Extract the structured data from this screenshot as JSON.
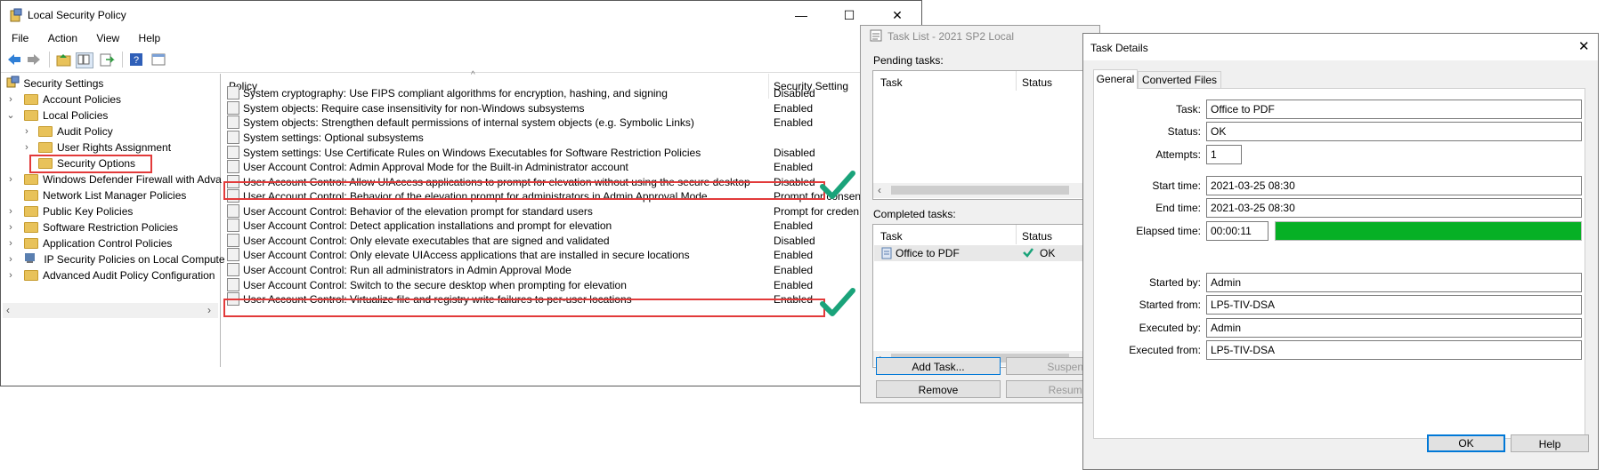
{
  "lsp": {
    "title": "Local Security Policy",
    "controls": {
      "minimize": "—",
      "maximize": "☐",
      "close": "✕"
    },
    "menu": [
      "File",
      "Action",
      "View",
      "Help"
    ],
    "tree": [
      {
        "label": "Security Settings",
        "level": 0
      },
      {
        "label": "Account Policies",
        "level": 1
      },
      {
        "label": "Local Policies",
        "level": 1
      },
      {
        "label": "Audit Policy",
        "level": 2
      },
      {
        "label": "User Rights Assignment",
        "level": 2
      },
      {
        "label": "Security Options",
        "level": 2
      },
      {
        "label": "Windows Defender Firewall with Adva",
        "level": 1
      },
      {
        "label": "Network List Manager Policies",
        "level": 1
      },
      {
        "label": "Public Key Policies",
        "level": 1
      },
      {
        "label": "Software Restriction Policies",
        "level": 1
      },
      {
        "label": "Application Control Policies",
        "level": 1
      },
      {
        "label": "IP Security Policies on Local Compute",
        "level": 1
      },
      {
        "label": "Advanced Audit Policy Configuration",
        "level": 1
      }
    ],
    "columns": {
      "policy": "Policy",
      "setting": "Security Setting"
    },
    "rows": [
      {
        "policy": "System cryptography: Use FIPS compliant algorithms for encryption, hashing, and signing",
        "setting": "Disabled"
      },
      {
        "policy": "System objects: Require case insensitivity for non-Windows subsystems",
        "setting": "Enabled"
      },
      {
        "policy": "System objects: Strengthen default permissions of internal system objects (e.g. Symbolic Links)",
        "setting": "Enabled"
      },
      {
        "policy": "System settings: Optional subsystems",
        "setting": ""
      },
      {
        "policy": "System settings: Use Certificate Rules on Windows Executables for Software Restriction Policies",
        "setting": "Disabled"
      },
      {
        "policy": "User Account Control: Admin Approval Mode for the Built-in Administrator account",
        "setting": "Enabled"
      },
      {
        "policy": "User Account Control: Allow UIAccess applications to prompt for elevation without using the secure desktop",
        "setting": "Disabled"
      },
      {
        "policy": "User Account Control: Behavior of the elevation prompt for administrators in Admin Approval Mode",
        "setting": "Prompt for consen"
      },
      {
        "policy": "User Account Control: Behavior of the elevation prompt for standard users",
        "setting": "Prompt for creden"
      },
      {
        "policy": "User Account Control: Detect application installations and prompt for elevation",
        "setting": "Enabled"
      },
      {
        "policy": "User Account Control: Only elevate executables that are signed and validated",
        "setting": "Disabled"
      },
      {
        "policy": "User Account Control: Only elevate UIAccess applications that are installed in secure locations",
        "setting": "Enabled"
      },
      {
        "policy": "User Account Control: Run all administrators in Admin Approval Mode",
        "setting": "Enabled"
      },
      {
        "policy": "User Account Control: Switch to the secure desktop when prompting for elevation",
        "setting": "Enabled"
      },
      {
        "policy": "User Account Control: Virtualize file and registry write failures to per-user locations",
        "setting": "Enabled"
      }
    ]
  },
  "tasklist": {
    "title": "Task List - 2021 SP2 Local",
    "pending_label": "Pending tasks:",
    "completed_label": "Completed tasks:",
    "col_task": "Task",
    "col_status": "Status",
    "completed_rows": [
      {
        "task": "Office to PDF",
        "status": "OK"
      }
    ],
    "buttons": {
      "add": "Add Task...",
      "suspend": "Suspend",
      "remove": "Remove",
      "resume": "Resume"
    }
  },
  "details": {
    "title": "Task Details",
    "tabs": [
      "General",
      "Converted Files"
    ],
    "fields": {
      "task": {
        "label": "Task:",
        "value": "Office to PDF"
      },
      "status": {
        "label": "Status:",
        "value": "OK"
      },
      "attempts": {
        "label": "Attempts:",
        "value": "1"
      },
      "start_time": {
        "label": "Start time:",
        "value": "2021-03-25 08:30"
      },
      "end_time": {
        "label": "End time:",
        "value": "2021-03-25 08:30"
      },
      "elapsed": {
        "label": "Elapsed time:",
        "value": "00:00:11"
      },
      "started_by": {
        "label": "Started by:",
        "value": "Admin"
      },
      "started_from": {
        "label": "Started from:",
        "value": "LP5-TIV-DSA"
      },
      "executed_by": {
        "label": "Executed by:",
        "value": "Admin"
      },
      "executed_from": {
        "label": "Executed from:",
        "value": "LP5-TIV-DSA"
      }
    },
    "progress_fraction": 1.0,
    "progress_color": "#06b025",
    "buttons": {
      "ok": "OK",
      "help": "Help"
    }
  },
  "colors": {
    "highlight_box": "#e23a3a",
    "checkmark": "#1aa37a"
  }
}
